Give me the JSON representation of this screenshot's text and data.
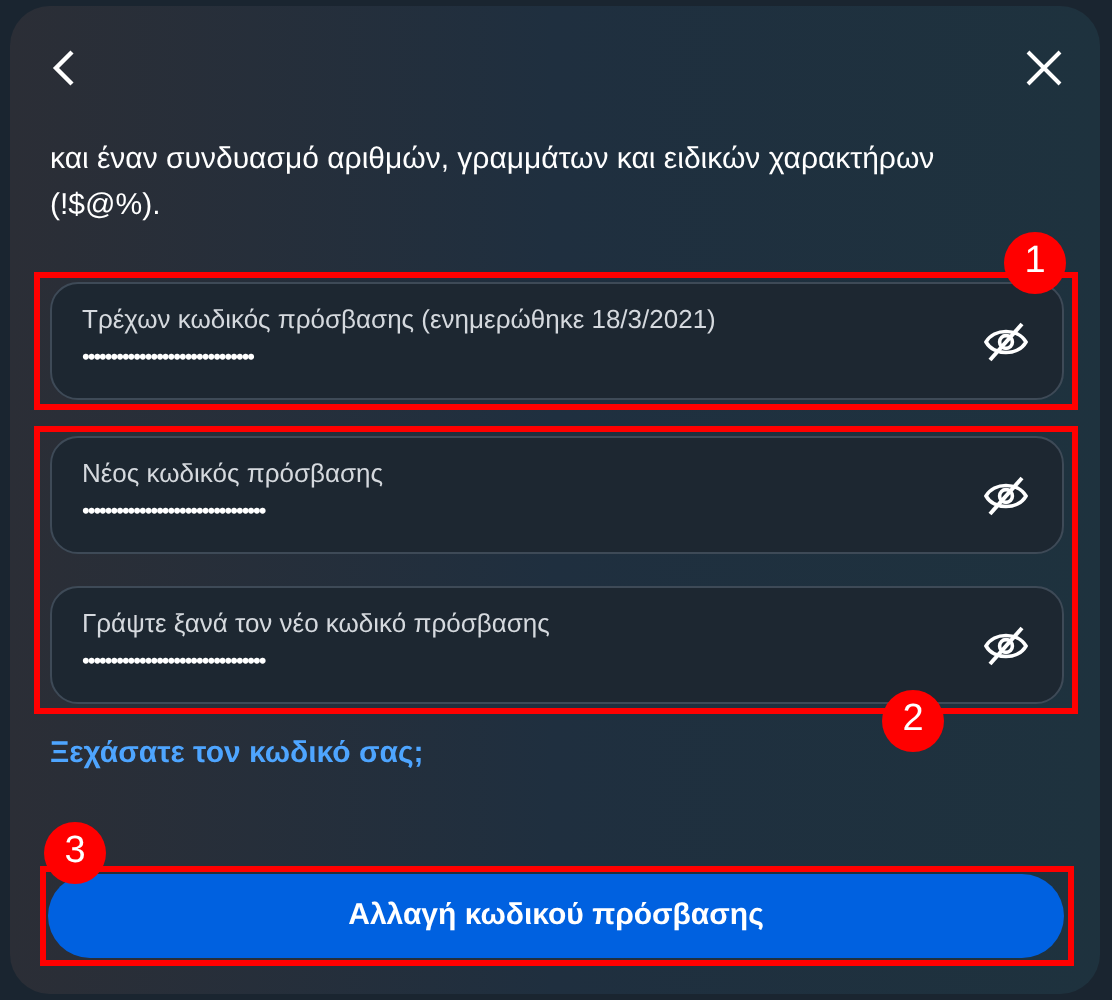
{
  "intro": "και έναν συνδυασμό αριθμών, γραμμάτων και ειδικών χαρακτήρων (!$@%).",
  "fields": [
    {
      "label": "Τρέχων κωδικός πρόσβασης (ενημερώθηκε 18/3/2021)",
      "value": "••••••••••••••••••••••••••••••",
      "masked": true
    },
    {
      "label": "Νέος κωδικός πρόσβασης",
      "value": "••••••••••••••••••••••••••••••••",
      "masked": true
    },
    {
      "label": "Γράψτε ξανά τον νέο κωδικό πρόσβασης",
      "value": "••••••••••••••••••••••••••••••••",
      "masked": true
    }
  ],
  "forgot_link": "Ξεχάσατε τον κωδικό σας;",
  "submit_button": "Αλλαγή κωδικού πρόσβασης",
  "annotations": [
    "1",
    "2",
    "3"
  ]
}
